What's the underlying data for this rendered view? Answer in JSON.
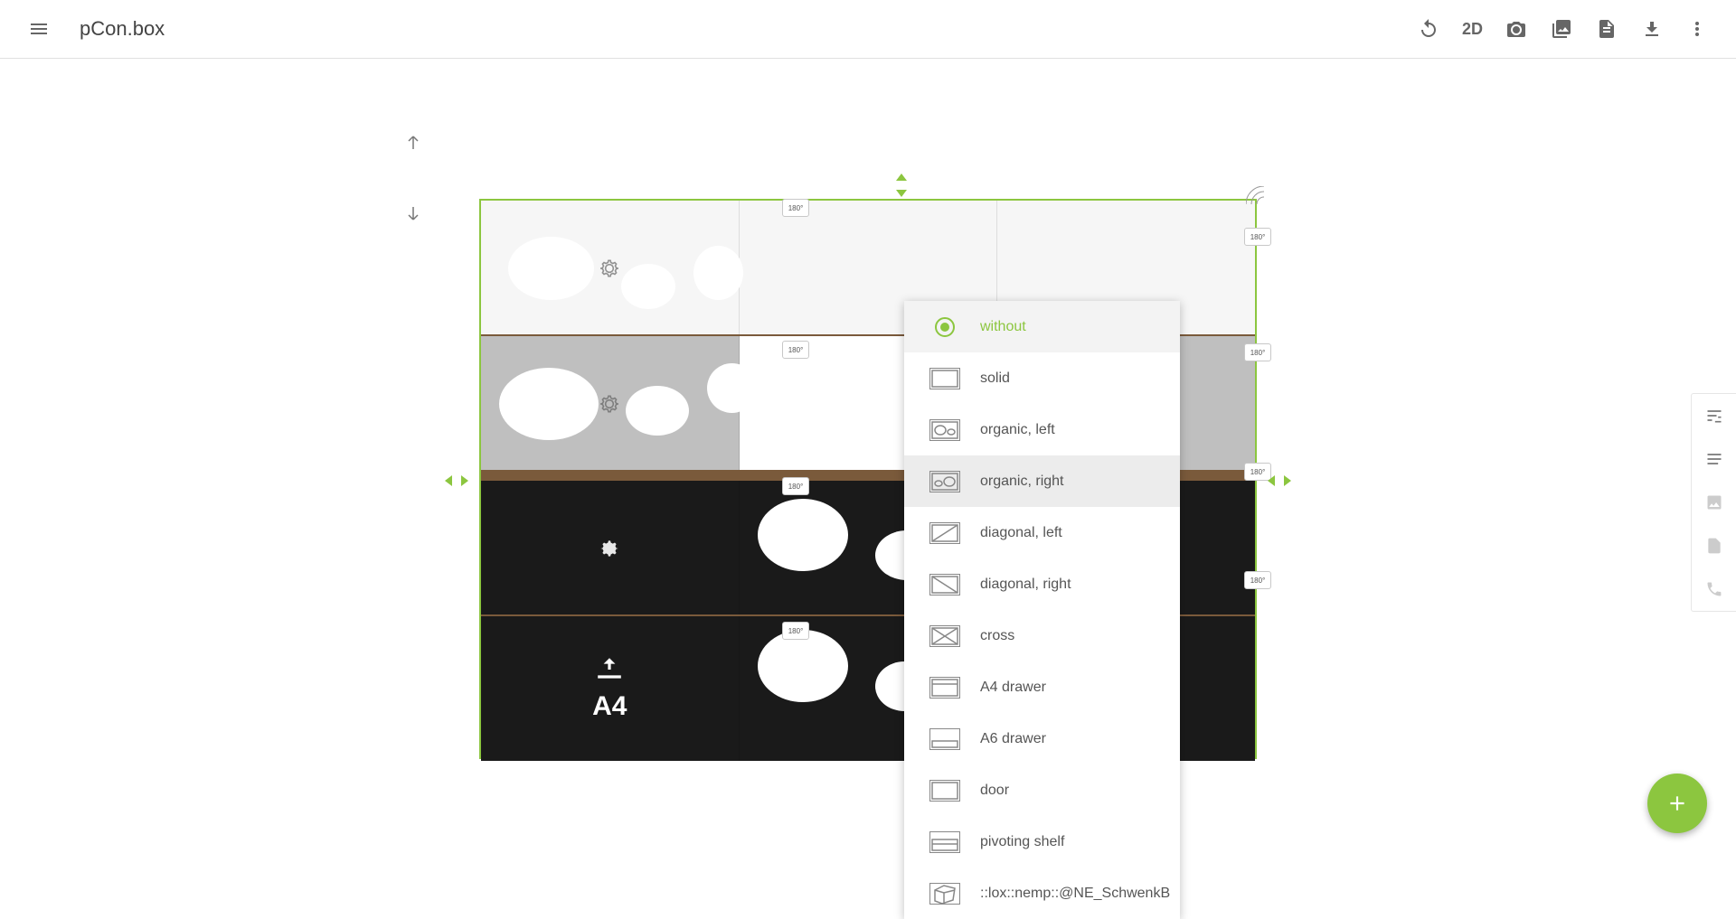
{
  "header": {
    "title": "pCon.box",
    "view_mode": "2D"
  },
  "canvas": {
    "a4_label": "A4",
    "flip_badge": "180°"
  },
  "popup": {
    "items": [
      {
        "key": "without",
        "label": "without",
        "icon": "radio",
        "selected": true
      },
      {
        "key": "solid",
        "label": "solid",
        "icon": "solid"
      },
      {
        "key": "organic_left",
        "label": "organic, left",
        "icon": "organic-l"
      },
      {
        "key": "organic_right",
        "label": "organic, right",
        "icon": "organic-r",
        "hover": true
      },
      {
        "key": "diagonal_left",
        "label": "diagonal, left",
        "icon": "diag-l"
      },
      {
        "key": "diagonal_right",
        "label": "diagonal, right",
        "icon": "diag-r"
      },
      {
        "key": "cross",
        "label": "cross",
        "icon": "cross"
      },
      {
        "key": "a4_drawer",
        "label": "A4 drawer",
        "icon": "a4"
      },
      {
        "key": "a6_drawer",
        "label": "A6 drawer",
        "icon": "a6"
      },
      {
        "key": "door",
        "label": "door",
        "icon": "solid"
      },
      {
        "key": "pivoting_shelf",
        "label": "pivoting shelf",
        "icon": "pivot"
      },
      {
        "key": "schwenkb",
        "label": "::lox::nemp::@NE_SchwenkB",
        "icon": "box3d"
      }
    ]
  }
}
